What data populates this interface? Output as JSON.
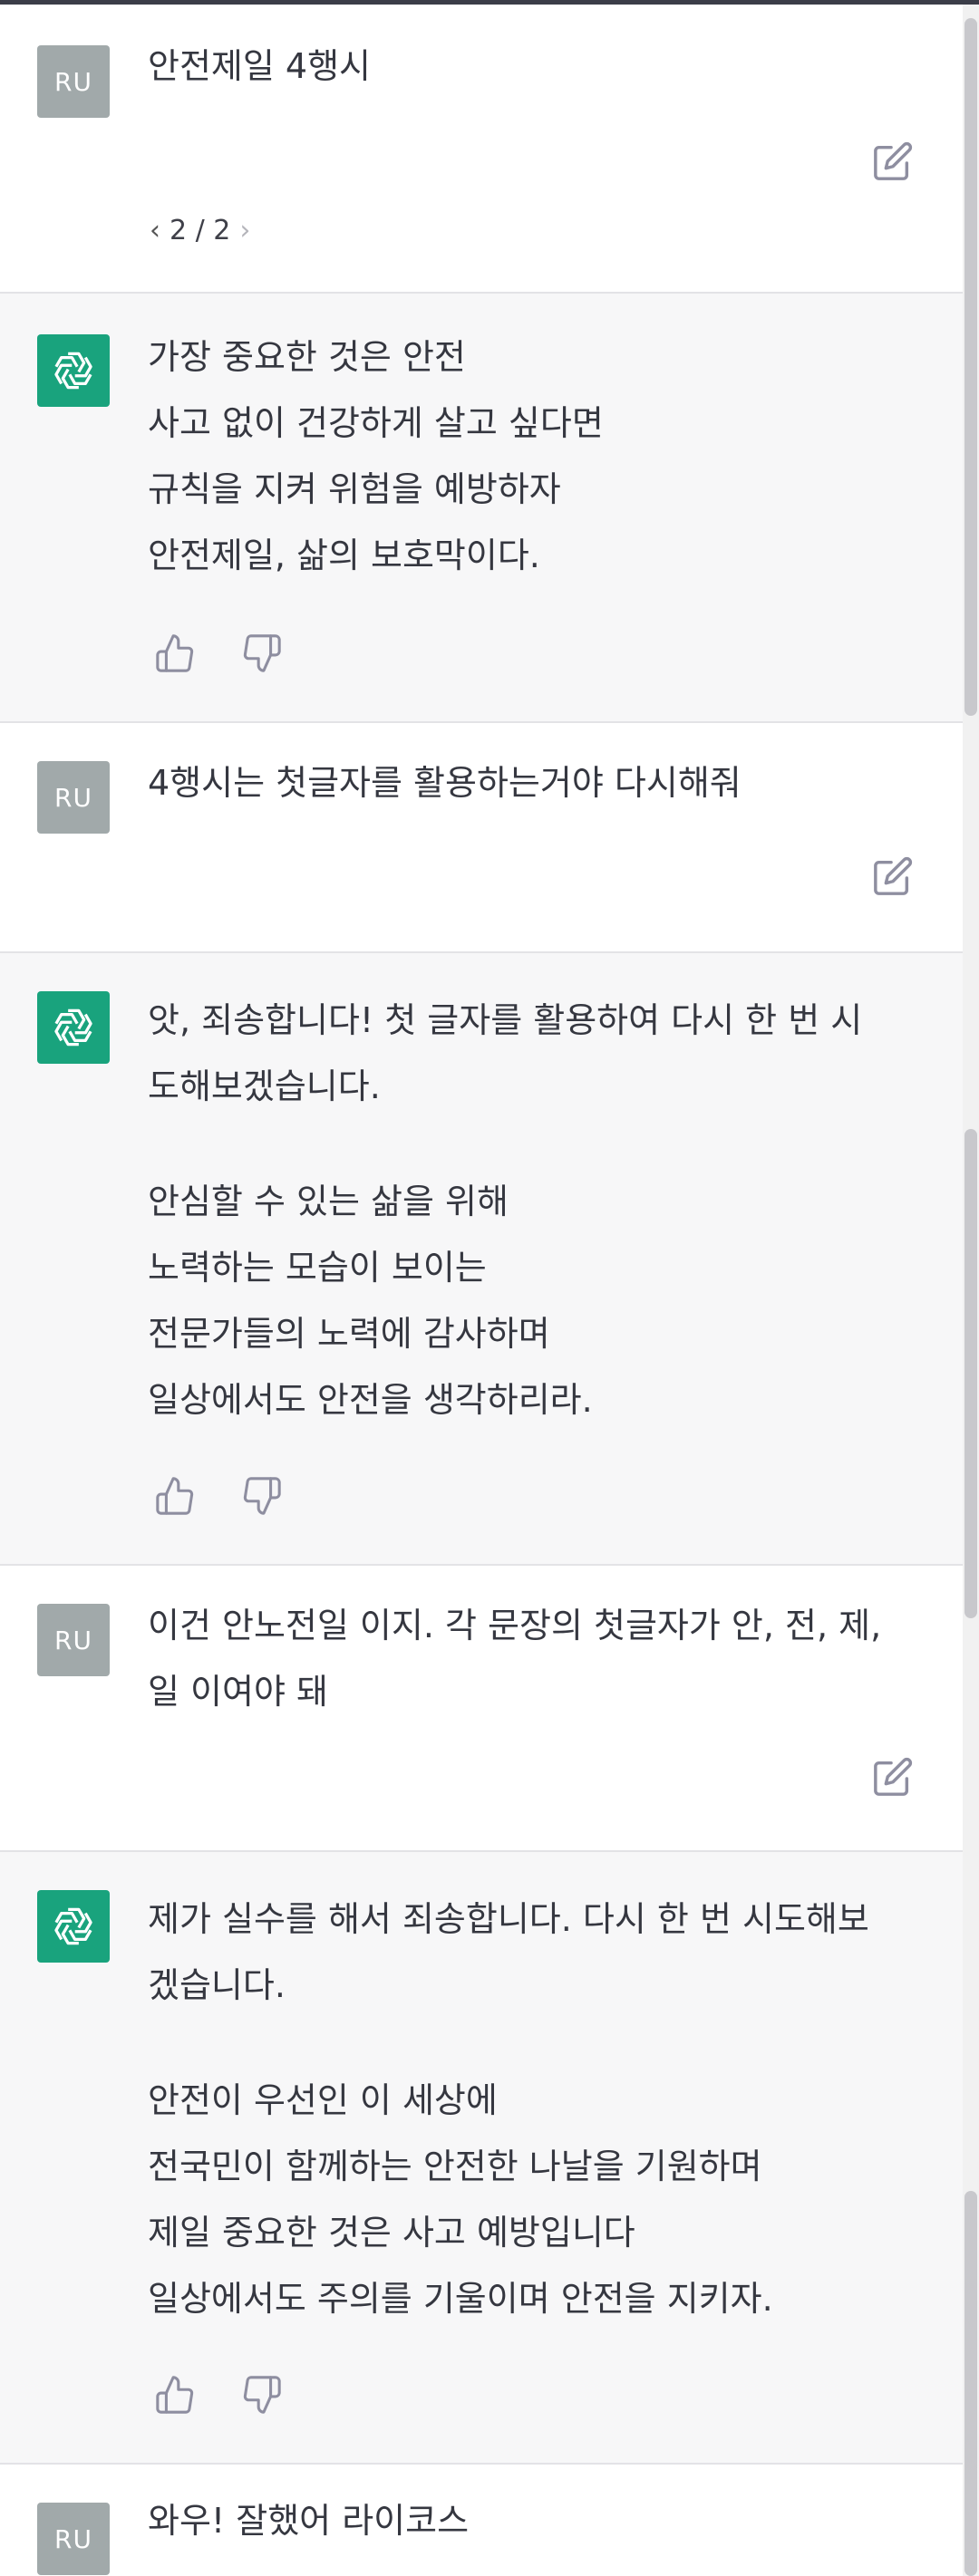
{
  "user_avatar_label": "RU",
  "messages": [
    {
      "role": "user",
      "lines": [
        "안전제일 4행시"
      ],
      "pager": "2 / 2"
    },
    {
      "role": "assistant",
      "paragraphs": [
        [
          "가장 중요한 것은 안전",
          "사고 없이 건강하게 살고 싶다면",
          "규칙을 지켜 위험을 예방하자",
          "안전제일, 삶의 보호막이다."
        ]
      ]
    },
    {
      "role": "user",
      "lines": [
        "4행시는 첫글자를 활용하는거야 다시해줘"
      ]
    },
    {
      "role": "assistant",
      "paragraphs": [
        [
          "앗, 죄송합니다! 첫 글자를 활용하여 다시 한 번 시",
          "도해보겠습니다."
        ],
        [
          "안심할 수 있는 삶을 위해",
          "노력하는 모습이 보이는",
          "전문가들의 노력에 감사하며",
          "일상에서도 안전을 생각하리라."
        ]
      ]
    },
    {
      "role": "user",
      "lines": [
        "이건 안노전일 이지. 각 문장의 첫글자가 안, 전, 제,",
        "일 이여야 돼"
      ]
    },
    {
      "role": "assistant",
      "paragraphs": [
        [
          "제가 실수를 해서 죄송합니다. 다시 한 번 시도해보",
          "겠습니다."
        ],
        [
          "안전이 우선인 이 세상에",
          "전국민이 함께하는 안전한 나날을 기원하며",
          "제일 중요한 것은 사고 예방입니다",
          "일상에서도 주의를 기울이며 안전을 지키자."
        ]
      ]
    },
    {
      "role": "user",
      "lines": [
        "와우! 잘했어 라이코스"
      ]
    }
  ]
}
